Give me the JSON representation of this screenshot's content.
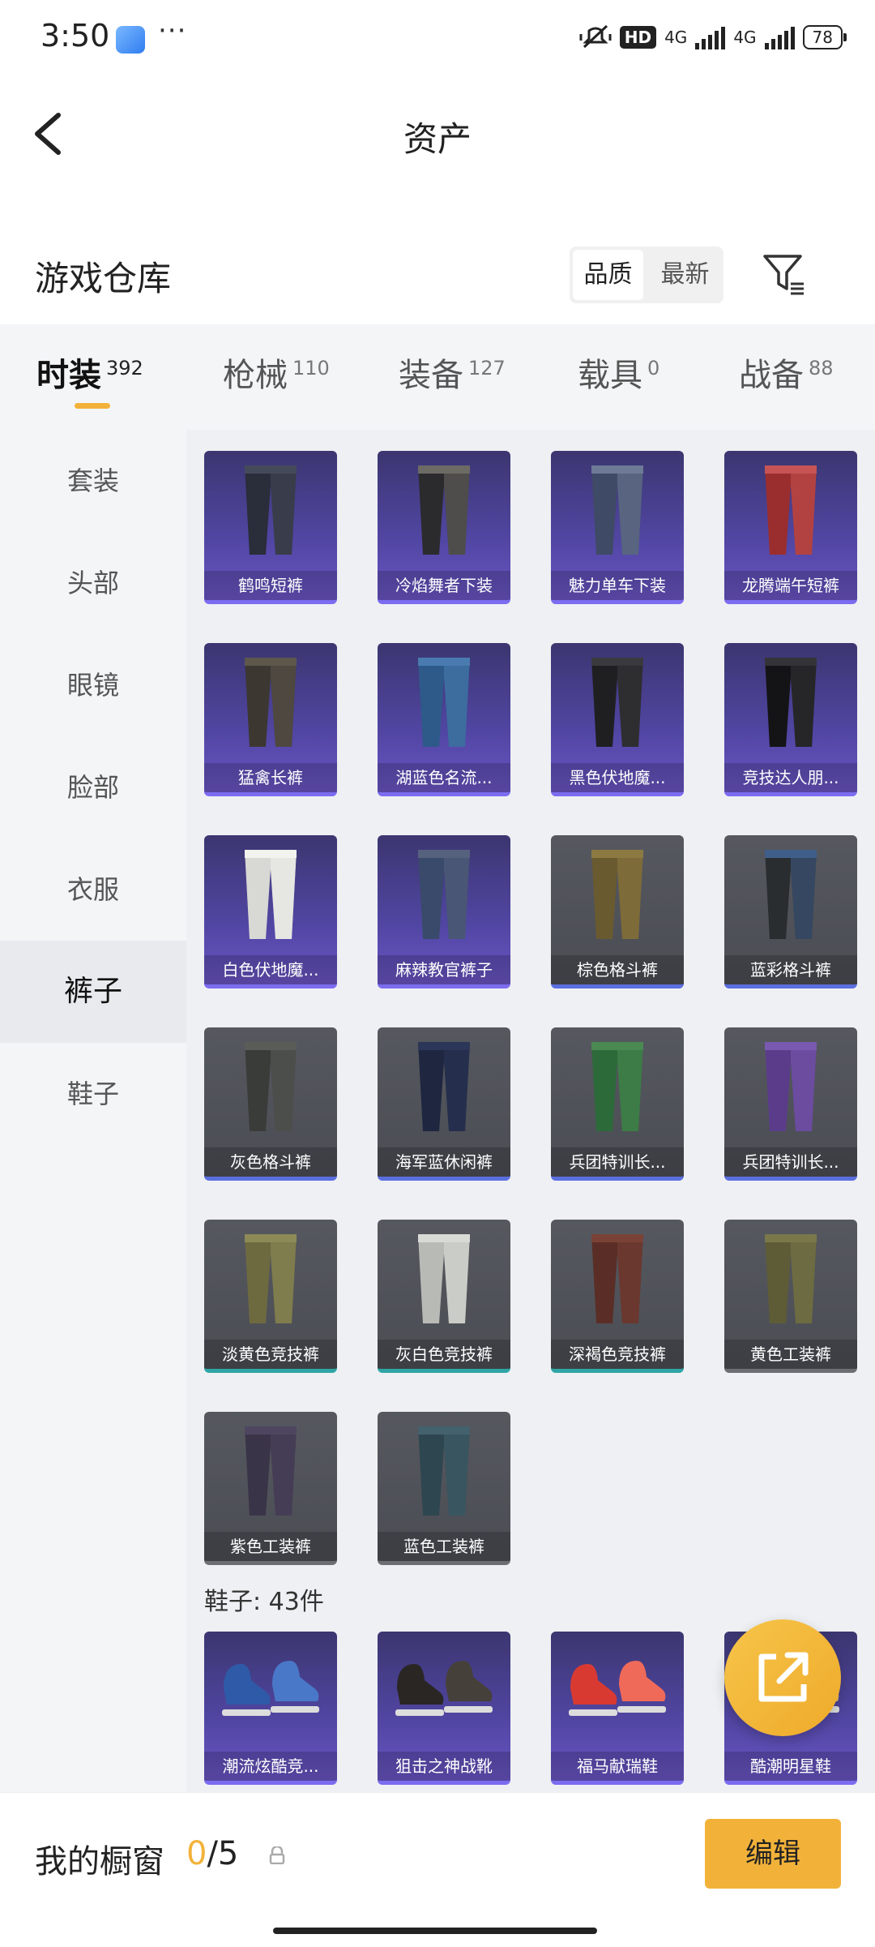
{
  "status_bar": {
    "time": "3:50",
    "network": "4G",
    "battery": "78"
  },
  "header": {
    "title": "资产"
  },
  "warehouse": {
    "title": "游戏仓库",
    "sort_options": [
      "品质",
      "最新"
    ],
    "sort_selected": "品质"
  },
  "tabs": [
    {
      "label": "时装",
      "count": "392",
      "active": true
    },
    {
      "label": "枪械",
      "count": "110"
    },
    {
      "label": "装备",
      "count": "127"
    },
    {
      "label": "载具",
      "count": "0"
    },
    {
      "label": "战备",
      "count": "88"
    }
  ],
  "sidebar": {
    "items": [
      "套装",
      "头部",
      "眼镜",
      "脸部",
      "衣服",
      "裤子",
      "鞋子"
    ],
    "selected": "裤子"
  },
  "items": [
    {
      "name": "鹤鸣短裤",
      "bg": "purple",
      "colors": [
        "#2a2d3a",
        "#454a5a"
      ]
    },
    {
      "name": "冷焰舞者下装",
      "bg": "purple",
      "colors": [
        "#2b2b2e",
        "#6d6a66"
      ]
    },
    {
      "name": "魅力单车下装",
      "bg": "purple",
      "colors": [
        "#3f4a66",
        "#6e7a96"
      ]
    },
    {
      "name": "龙腾端午短裤",
      "bg": "purple",
      "colors": [
        "#9a2e2e",
        "#c75454"
      ]
    },
    {
      "name": "猛禽长裤",
      "bg": "purple",
      "colors": [
        "#3c3731",
        "#5e574c"
      ]
    },
    {
      "name": "湖蓝色名流长裤",
      "display": "湖蓝色名流...",
      "bg": "purple",
      "colors": [
        "#2e5a8a",
        "#4a7bb0"
      ]
    },
    {
      "name": "黑色伏地魔长裤",
      "display": "黑色伏地魔...",
      "bg": "purple",
      "colors": [
        "#1f1f22",
        "#3a3a3e"
      ]
    },
    {
      "name": "竞技达人朋克裤",
      "display": "竞技达人朋...",
      "bg": "purple",
      "colors": [
        "#141416",
        "#343438"
      ]
    },
    {
      "name": "白色伏地魔长裤",
      "display": "白色伏地魔...",
      "bg": "purple",
      "colors": [
        "#d8d8d4",
        "#f2f2ee"
      ]
    },
    {
      "name": "麻辣教官裤子",
      "bg": "purple",
      "colors": [
        "#3a4a6a",
        "#56617e"
      ]
    },
    {
      "name": "棕色格斗裤",
      "bg": "gray",
      "border": "blue",
      "colors": [
        "#6a5a30",
        "#8c7a42"
      ]
    },
    {
      "name": "蓝彩格斗裤",
      "bg": "gray",
      "border": "blue",
      "colors": [
        "#2a2d30",
        "#3f5f8a"
      ]
    },
    {
      "name": "灰色格斗裤",
      "bg": "gray",
      "border": "blue",
      "colors": [
        "#3a3c3a",
        "#5a5c58"
      ]
    },
    {
      "name": "海军蓝休闲裤",
      "bg": "gray",
      "border": "blue",
      "colors": [
        "#1e2640",
        "#2c3658"
      ]
    },
    {
      "name": "兵团特训长裤",
      "display": "兵团特训长...",
      "bg": "gray",
      "border": "blue",
      "colors": [
        "#2d6a3a",
        "#4a8a52"
      ]
    },
    {
      "name": "兵团特训长裤",
      "display": "兵团特训长...",
      "bg": "gray",
      "border": "blue",
      "colors": [
        "#5a3c8a",
        "#7a5ab0"
      ]
    },
    {
      "name": "淡黄色竞技裤",
      "bg": "gray",
      "border": "teal",
      "colors": [
        "#6e6a40",
        "#8e8a58"
      ]
    },
    {
      "name": "灰白色竞技裤",
      "bg": "gray",
      "border": "teal",
      "colors": [
        "#b8bab6",
        "#d8dad6"
      ]
    },
    {
      "name": "深褐色竞技裤",
      "bg": "gray",
      "border": "teal",
      "colors": [
        "#5a2e26",
        "#7a4236"
      ]
    },
    {
      "name": "黄色工装裤",
      "bg": "gray",
      "border": "plain",
      "colors": [
        "#5e5c36",
        "#7a784a"
      ]
    },
    {
      "name": "紫色工装裤",
      "bg": "gray",
      "border": "plain",
      "colors": [
        "#3a3448",
        "#4e4660"
      ]
    },
    {
      "name": "蓝色工装裤",
      "bg": "gray",
      "border": "plain",
      "colors": [
        "#2e4650",
        "#44626e"
      ]
    }
  ],
  "shoes_section": {
    "label": "鞋子: 43件"
  },
  "shoes": [
    {
      "name": "潮流炫酷竞技鞋",
      "display": "潮流炫酷竞...",
      "colors": [
        "#2f5aa8",
        "#4a78c8"
      ]
    },
    {
      "name": "狙击之神战靴",
      "colors": [
        "#2a2624",
        "#46403a"
      ]
    },
    {
      "name": "福马献瑞鞋",
      "colors": [
        "#d83a32",
        "#f06a5a"
      ]
    },
    {
      "name": "酷潮明星鞋",
      "colors": [
        "#c9a04a",
        "#e0bd6a"
      ]
    }
  ],
  "bottom_bar": {
    "label": "我的橱窗",
    "current": "0",
    "total": "/5",
    "edit_label": "编辑"
  },
  "colors": {
    "accent": "#f2b23a",
    "purple_card": "#5146a3",
    "gray_card": "#4b4d54"
  }
}
